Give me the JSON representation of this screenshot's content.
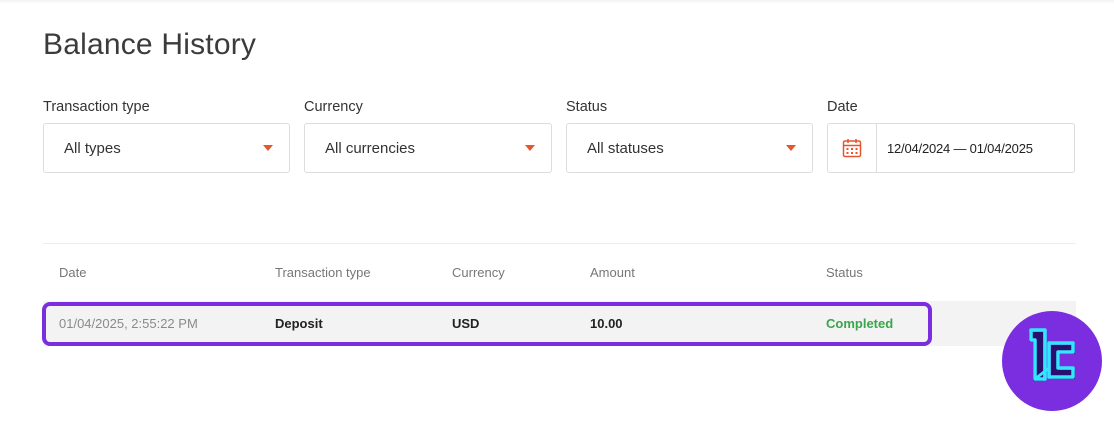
{
  "page": {
    "title": "Balance History"
  },
  "filters": {
    "transaction_type": {
      "label": "Transaction type",
      "value": "All types"
    },
    "currency": {
      "label": "Currency",
      "value": "All currencies"
    },
    "status": {
      "label": "Status",
      "value": "All statuses"
    },
    "date": {
      "label": "Date",
      "range": "12/04/2024 — 01/04/2025"
    }
  },
  "table": {
    "headers": [
      "Date",
      "Transaction type",
      "Currency",
      "Amount",
      "Status"
    ],
    "rows": [
      {
        "date": "01/04/2025, 2:55:22 PM",
        "type": "Deposit",
        "currency": "USD",
        "amount": "10.00",
        "status": "Completed"
      }
    ]
  },
  "colors": {
    "accent": "#e8542c",
    "status_completed": "#3aa64a",
    "highlight": "#7a2ee0",
    "logo_bg": "#7a2ee0",
    "logo_fg": "#33e6ff"
  },
  "icons": [
    "chevron-down-icon",
    "calendar-icon",
    "brand-logo"
  ]
}
